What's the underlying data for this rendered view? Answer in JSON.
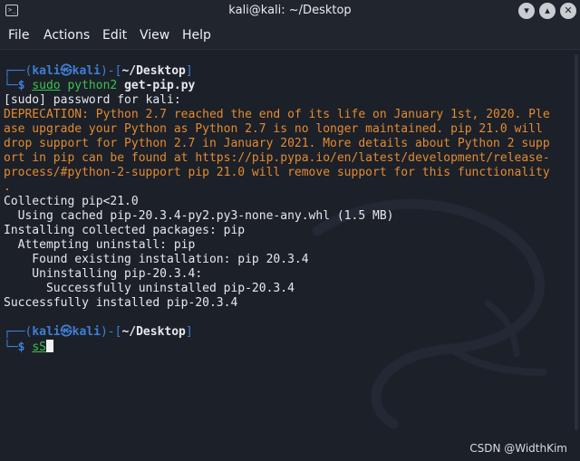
{
  "window": {
    "title": "kali@kali: ~/Desktop",
    "controls": [
      "minimize-icon",
      "maximize-icon",
      "close-icon"
    ]
  },
  "menu": [
    "File",
    "Actions",
    "Edit",
    "View",
    "Help"
  ],
  "prompt": {
    "box_left": "┌──(",
    "user": "kali",
    "at": "㉿",
    "host": "kali",
    "box_mid": ")-[",
    "path": "~/Desktop",
    "box_right": "]",
    "corner": "└─",
    "dollar": "$"
  },
  "commands": {
    "first_sudo": "sudo",
    "first_rest": " python2 ",
    "first_script": "get-pip.py",
    "second": "sS"
  },
  "output": {
    "sudo_prompt": "[sudo] password for kali:",
    "deprecation": [
      "DEPRECATION: Python 2.7 reached the end of its life on January 1st, 2020. Ple",
      "ase upgrade your Python as Python 2.7 is no longer maintained. pip 21.0 will",
      "drop support for Python 2.7 in January 2021. More details about Python 2 supp",
      "ort in pip can be found at https://pip.pypa.io/en/latest/development/release-",
      "process/#python-2-support pip 21.0 will remove support for this functionality",
      "."
    ],
    "normal": [
      "Collecting pip<21.0",
      "  Using cached pip-20.3.4-py2.py3-none-any.whl (1.5 MB)",
      "Installing collected packages: pip",
      "  Attempting uninstall: pip",
      "    Found existing installation: pip 20.3.4",
      "    Uninstalling pip-20.3.4:",
      "      Successfully uninstalled pip-20.3.4",
      "Successfully installed pip-20.3.4"
    ]
  },
  "watermark": "CSDN @WidthKim",
  "colors": {
    "background": "#1c2029",
    "prompt_blue": "#3f7fd6",
    "prompt_green": "#3ac34e",
    "warning_orange": "#e38b30"
  }
}
